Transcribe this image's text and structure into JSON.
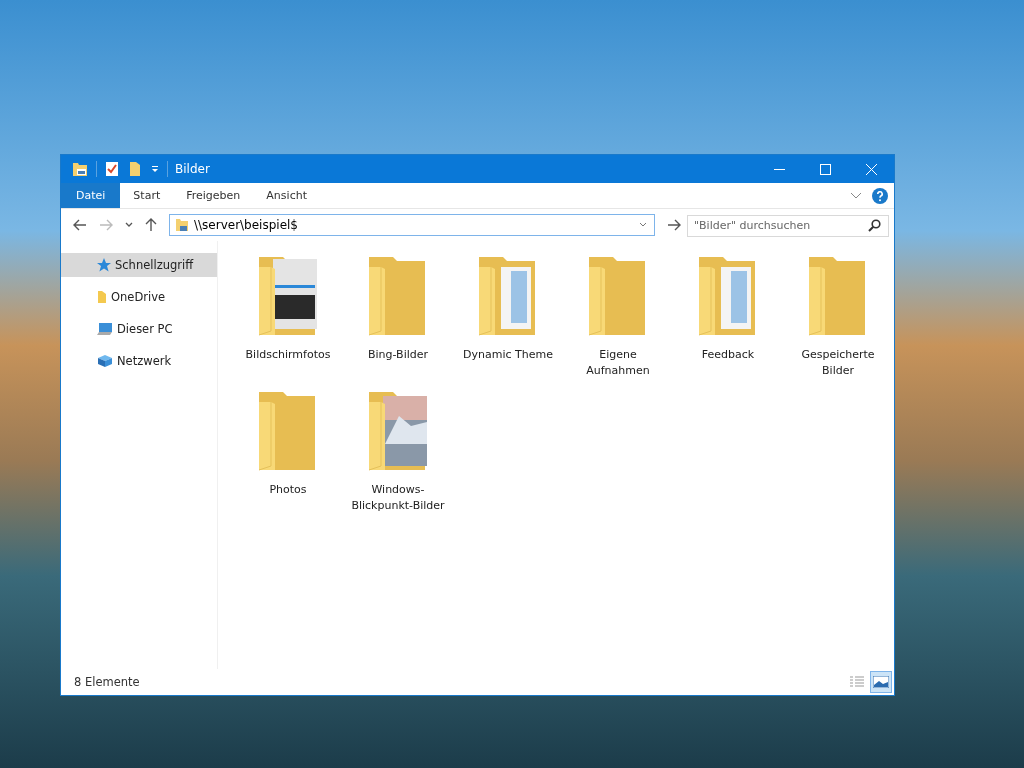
{
  "window": {
    "title": "Bilder"
  },
  "ribbon_tabs": [
    {
      "label": "Datei",
      "selected": true
    },
    {
      "label": "Start",
      "selected": false
    },
    {
      "label": "Freigeben",
      "selected": false
    },
    {
      "label": "Ansicht",
      "selected": false
    }
  ],
  "address": {
    "value": "\\\\server\\beispiel$"
  },
  "search": {
    "placeholder": "\"Bilder\" durchsuchen"
  },
  "sidebar": {
    "items": [
      {
        "label": "Schnellzugriff",
        "kind": "star",
        "selected": true
      },
      {
        "label": "OneDrive",
        "kind": "cloud",
        "selected": false
      },
      {
        "label": "Dieser PC",
        "kind": "pc",
        "selected": false
      },
      {
        "label": "Netzwerk",
        "kind": "network",
        "selected": false
      }
    ]
  },
  "folders": [
    {
      "name": "Bildschirmfotos",
      "kind": "screenshot"
    },
    {
      "name": "Bing-Bilder",
      "kind": "plain"
    },
    {
      "name": "Dynamic Theme",
      "kind": "documents"
    },
    {
      "name": "Eigene Aufnahmen",
      "kind": "plain"
    },
    {
      "name": "Feedback",
      "kind": "documents"
    },
    {
      "name": "Gespeicherte Bilder",
      "kind": "plain"
    },
    {
      "name": "Photos",
      "kind": "plain"
    },
    {
      "name": "Windows-Blickpunkt-Bilder",
      "kind": "photo"
    }
  ],
  "status_bar": {
    "count": "8 Elemente",
    "views": [
      {
        "kind": "details",
        "selected": false
      },
      {
        "kind": "large-icons",
        "selected": true
      }
    ]
  }
}
